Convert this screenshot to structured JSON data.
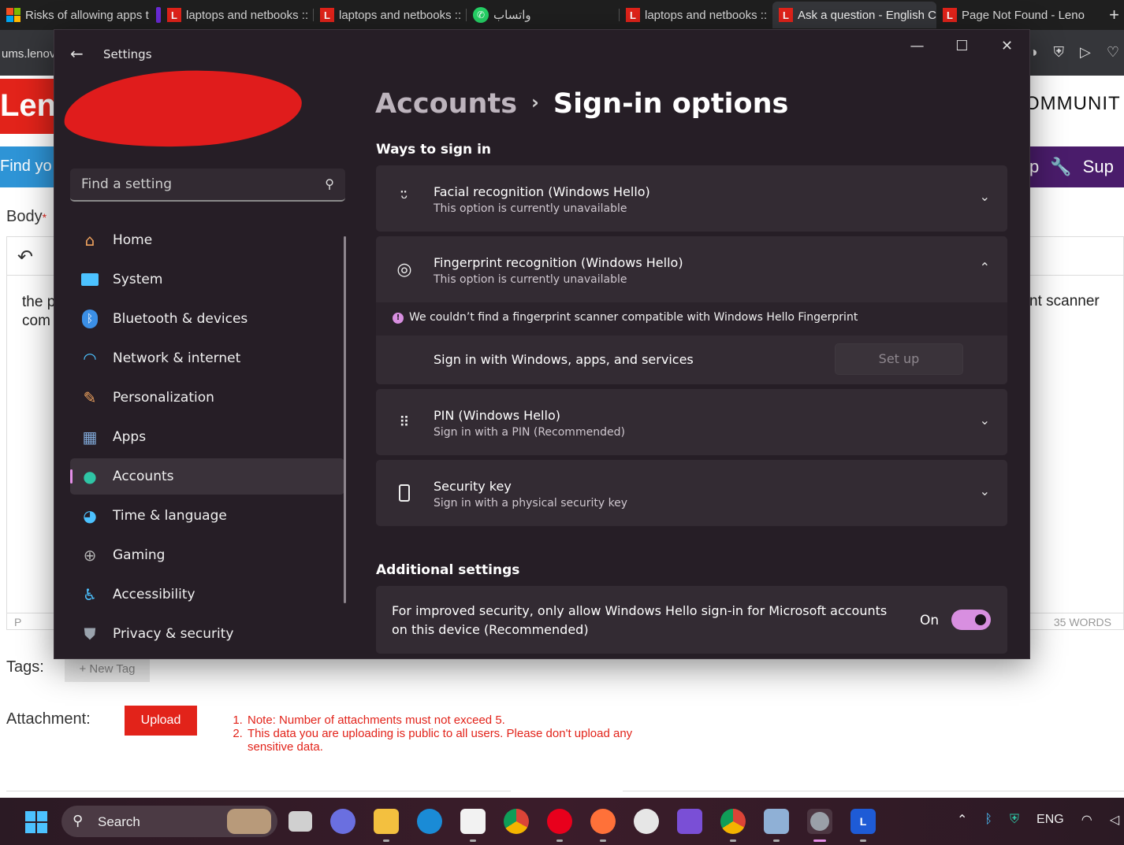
{
  "browser": {
    "tabs": [
      {
        "title": "Risks of allowing apps t",
        "icon": "windows-logo"
      },
      {
        "title": "laptops and netbooks ::",
        "icon": "lenovo-l"
      },
      {
        "title": "laptops and netbooks ::",
        "icon": "lenovo-l"
      },
      {
        "title": "واتساب",
        "icon": "whatsapp"
      },
      {
        "title": "laptops and netbooks ::",
        "icon": "lenovo-l"
      },
      {
        "title": "Ask a question - English C",
        "icon": "lenovo-l",
        "active": true
      },
      {
        "title": "Page Not Found - Leno",
        "icon": "lenovo-l"
      }
    ],
    "new_tab": "+",
    "address_partial": "ums.lenov"
  },
  "page_behind": {
    "logo_partial": "Len",
    "community_partial": "OMMUNIT",
    "search_partial": "Find yo",
    "nav_partial": "p",
    "nav_support_partial": "Sup",
    "body_label": "Body",
    "required_mark": "*",
    "editor_text_left_line1": "the p",
    "editor_text_left_line2": "com",
    "editor_text_right": "nt scanner",
    "footer_tag": "P",
    "word_count": "35 WORDS",
    "tags_label": "Tags:",
    "new_tag": "+ New Tag",
    "attachment_label": "Attachment:",
    "upload_label": "Upload",
    "notes": [
      "Note: Number of attachments must not exceed 5.",
      "This data you are uploading is public to all users. Please don't upload any sensitive data."
    ]
  },
  "settings": {
    "window_title": "Settings",
    "search_placeholder": "Find a setting",
    "nav": [
      {
        "label": "Home",
        "icon": "home-icon",
        "color": "#f0a35e"
      },
      {
        "label": "System",
        "icon": "system-icon",
        "color": "#4cc2ff"
      },
      {
        "label": "Bluetooth & devices",
        "icon": "bluetooth-icon",
        "color": "#3b8fe6"
      },
      {
        "label": "Network & internet",
        "icon": "wifi-icon",
        "color": "#4cc2ff"
      },
      {
        "label": "Personalization",
        "icon": "brush-icon",
        "color": "#f0a35e"
      },
      {
        "label": "Apps",
        "icon": "apps-icon",
        "color": "#7fa7d6"
      },
      {
        "label": "Accounts",
        "icon": "person-icon",
        "color": "#2fc5a5",
        "selected": true
      },
      {
        "label": "Time & language",
        "icon": "globe-clock-icon",
        "color": "#4cc2ff"
      },
      {
        "label": "Gaming",
        "icon": "gamepad-icon",
        "color": "#b0b0b0"
      },
      {
        "label": "Accessibility",
        "icon": "accessibility-icon",
        "color": "#4cc2ff"
      },
      {
        "label": "Privacy & security",
        "icon": "shield-icon",
        "color": "#9aa3ad"
      }
    ],
    "breadcrumb": {
      "parent": "Accounts",
      "separator": "›",
      "current": "Sign-in options"
    },
    "ways_title": "Ways to sign in",
    "facial": {
      "title": "Facial recognition (Windows Hello)",
      "subtitle": "This option is currently unavailable"
    },
    "fingerprint": {
      "title": "Fingerprint recognition (Windows Hello)",
      "subtitle": "This option is currently unavailable",
      "warning": "We couldn’t find a fingerprint scanner compatible with Windows Hello Fingerprint",
      "sign_in_label": "Sign in with Windows, apps, and services",
      "setup_button": "Set up"
    },
    "pin": {
      "title": "PIN (Windows Hello)",
      "subtitle": "Sign in with a PIN (Recommended)"
    },
    "security_key": {
      "title": "Security key",
      "subtitle": "Sign in with a physical security key"
    },
    "additional_title": "Additional settings",
    "hello_only": {
      "text": "For improved security, only allow Windows Hello sign-in for Microsoft accounts on this device (Recommended)",
      "state_label": "On",
      "enabled": true
    }
  },
  "taskbar": {
    "search_label": "Search",
    "language": "ENG",
    "apps": [
      "task-view",
      "teams-chat",
      "file-explorer",
      "edge",
      "microsoft-store",
      "chrome",
      "opera",
      "firefox",
      "clock",
      "visual-studio",
      "chrome",
      "remote-desktop",
      "settings",
      "lenovo"
    ]
  },
  "colors": {
    "settings_bg": "#261e26",
    "card_bg": "#332b33",
    "accent": "#d88fe0",
    "lenovo_red": "#e2231a"
  }
}
